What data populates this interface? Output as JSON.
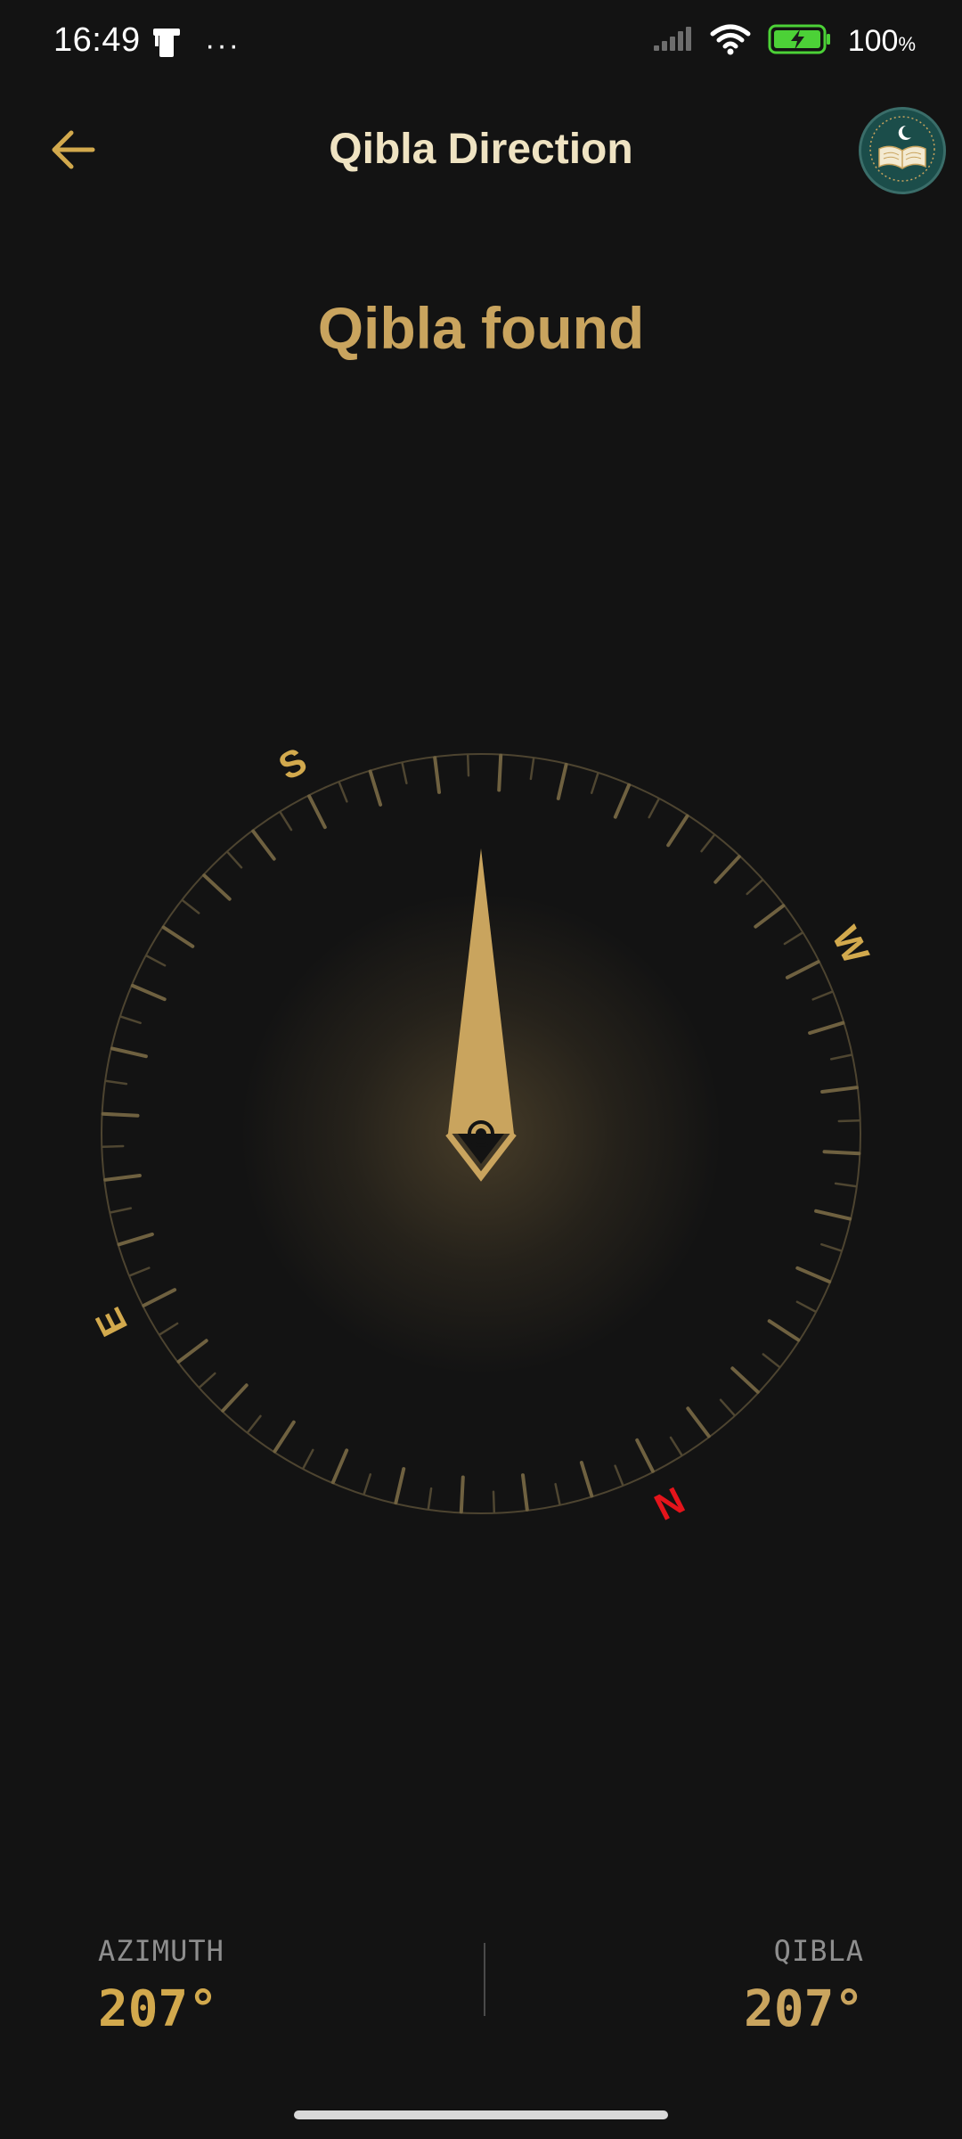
{
  "status_bar": {
    "time": "16:49",
    "more_indicator": "···",
    "battery": "100",
    "battery_unit": "%"
  },
  "header": {
    "title": "Qibla Direction"
  },
  "qibla": {
    "status": "Qibla found"
  },
  "compass": {
    "labels": {
      "north": "N",
      "east": "E",
      "south": "S",
      "west": "W"
    },
    "dial_heading_deg": 207,
    "needle_heading_deg": 0
  },
  "readouts": {
    "azimuth_label": "AZIMUTH",
    "azimuth_value": "207°",
    "qibla_label": "QIBLA",
    "qibla_value": "207°"
  },
  "colors": {
    "background": "#131313",
    "accent_gold": "#c9a45e",
    "label_gold": "#d2a94d",
    "north_red": "#e4141b",
    "battery_green": "#4cd137"
  }
}
